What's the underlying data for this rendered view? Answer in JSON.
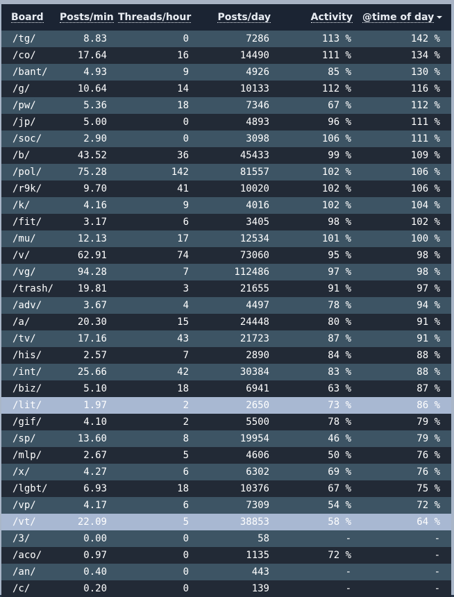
{
  "columns": [
    "Board",
    "Posts/min",
    "Threads/hour",
    "Posts/day",
    "Activity",
    "@time of day"
  ],
  "rows": [
    {
      "board": "/tg/",
      "ppm": "8.83",
      "tph": "0",
      "ppd": "7286",
      "act": "113 %",
      "tod": "142 %",
      "hl": false
    },
    {
      "board": "/co/",
      "ppm": "17.64",
      "tph": "16",
      "ppd": "14490",
      "act": "111 %",
      "tod": "134 %",
      "hl": false
    },
    {
      "board": "/bant/",
      "ppm": "4.93",
      "tph": "9",
      "ppd": "4926",
      "act": "85 %",
      "tod": "130 %",
      "hl": false
    },
    {
      "board": "/g/",
      "ppm": "10.64",
      "tph": "14",
      "ppd": "10133",
      "act": "112 %",
      "tod": "116 %",
      "hl": false
    },
    {
      "board": "/pw/",
      "ppm": "5.36",
      "tph": "18",
      "ppd": "7346",
      "act": "67 %",
      "tod": "112 %",
      "hl": false
    },
    {
      "board": "/jp/",
      "ppm": "5.00",
      "tph": "0",
      "ppd": "4893",
      "act": "96 %",
      "tod": "111 %",
      "hl": false
    },
    {
      "board": "/soc/",
      "ppm": "2.90",
      "tph": "0",
      "ppd": "3098",
      "act": "106 %",
      "tod": "111 %",
      "hl": false
    },
    {
      "board": "/b/",
      "ppm": "43.52",
      "tph": "36",
      "ppd": "45433",
      "act": "99 %",
      "tod": "109 %",
      "hl": false
    },
    {
      "board": "/pol/",
      "ppm": "75.28",
      "tph": "142",
      "ppd": "81557",
      "act": "102 %",
      "tod": "106 %",
      "hl": false
    },
    {
      "board": "/r9k/",
      "ppm": "9.70",
      "tph": "41",
      "ppd": "10020",
      "act": "102 %",
      "tod": "106 %",
      "hl": false
    },
    {
      "board": "/k/",
      "ppm": "4.16",
      "tph": "9",
      "ppd": "4016",
      "act": "102 %",
      "tod": "104 %",
      "hl": false
    },
    {
      "board": "/fit/",
      "ppm": "3.17",
      "tph": "6",
      "ppd": "3405",
      "act": "98 %",
      "tod": "102 %",
      "hl": false
    },
    {
      "board": "/mu/",
      "ppm": "12.13",
      "tph": "17",
      "ppd": "12534",
      "act": "101 %",
      "tod": "100 %",
      "hl": false
    },
    {
      "board": "/v/",
      "ppm": "62.91",
      "tph": "74",
      "ppd": "73060",
      "act": "95 %",
      "tod": "98 %",
      "hl": false
    },
    {
      "board": "/vg/",
      "ppm": "94.28",
      "tph": "7",
      "ppd": "112486",
      "act": "97 %",
      "tod": "98 %",
      "hl": false
    },
    {
      "board": "/trash/",
      "ppm": "19.81",
      "tph": "3",
      "ppd": "21655",
      "act": "91 %",
      "tod": "97 %",
      "hl": false
    },
    {
      "board": "/adv/",
      "ppm": "3.67",
      "tph": "4",
      "ppd": "4497",
      "act": "78 %",
      "tod": "94 %",
      "hl": false
    },
    {
      "board": "/a/",
      "ppm": "20.30",
      "tph": "15",
      "ppd": "24448",
      "act": "80 %",
      "tod": "91 %",
      "hl": false
    },
    {
      "board": "/tv/",
      "ppm": "17.16",
      "tph": "43",
      "ppd": "21723",
      "act": "87 %",
      "tod": "91 %",
      "hl": false
    },
    {
      "board": "/his/",
      "ppm": "2.57",
      "tph": "7",
      "ppd": "2890",
      "act": "84 %",
      "tod": "88 %",
      "hl": false
    },
    {
      "board": "/int/",
      "ppm": "25.66",
      "tph": "42",
      "ppd": "30384",
      "act": "83 %",
      "tod": "88 %",
      "hl": false
    },
    {
      "board": "/biz/",
      "ppm": "5.10",
      "tph": "18",
      "ppd": "6941",
      "act": "63 %",
      "tod": "87 %",
      "hl": false
    },
    {
      "board": "/lit/",
      "ppm": "1.97",
      "tph": "2",
      "ppd": "2650",
      "act": "73 %",
      "tod": "86 %",
      "hl": true
    },
    {
      "board": "/gif/",
      "ppm": "4.10",
      "tph": "2",
      "ppd": "5500",
      "act": "78 %",
      "tod": "79 %",
      "hl": false
    },
    {
      "board": "/sp/",
      "ppm": "13.60",
      "tph": "8",
      "ppd": "19954",
      "act": "46 %",
      "tod": "79 %",
      "hl": false
    },
    {
      "board": "/mlp/",
      "ppm": "2.67",
      "tph": "5",
      "ppd": "4606",
      "act": "50 %",
      "tod": "76 %",
      "hl": false
    },
    {
      "board": "/x/",
      "ppm": "4.27",
      "tph": "6",
      "ppd": "6302",
      "act": "69 %",
      "tod": "76 %",
      "hl": false
    },
    {
      "board": "/lgbt/",
      "ppm": "6.93",
      "tph": "18",
      "ppd": "10376",
      "act": "67 %",
      "tod": "75 %",
      "hl": false
    },
    {
      "board": "/vp/",
      "ppm": "4.17",
      "tph": "6",
      "ppd": "7309",
      "act": "54 %",
      "tod": "72 %",
      "hl": false
    },
    {
      "board": "/vt/",
      "ppm": "22.09",
      "tph": "5",
      "ppd": "38853",
      "act": "58 %",
      "tod": "64 %",
      "hl": true
    },
    {
      "board": "/3/",
      "ppm": "0.00",
      "tph": "0",
      "ppd": "58",
      "act": "-",
      "tod": "-",
      "hl": false
    },
    {
      "board": "/aco/",
      "ppm": "0.97",
      "tph": "0",
      "ppd": "1135",
      "act": "72 %",
      "tod": "-",
      "hl": false
    },
    {
      "board": "/an/",
      "ppm": "0.40",
      "tph": "0",
      "ppd": "443",
      "act": "-",
      "tod": "-",
      "hl": false
    },
    {
      "board": "/c/",
      "ppm": "0.20",
      "tph": "0",
      "ppd": "139",
      "act": "-",
      "tod": "-",
      "hl": false
    }
  ],
  "sorted_column_icon": "chevron-down-icon",
  "colors": {
    "header_bg": "#1b2433",
    "row_odd": "#3d5464",
    "row_even": "#222a36",
    "row_highlight": "#a8b8d2",
    "text": "#ffffff"
  }
}
